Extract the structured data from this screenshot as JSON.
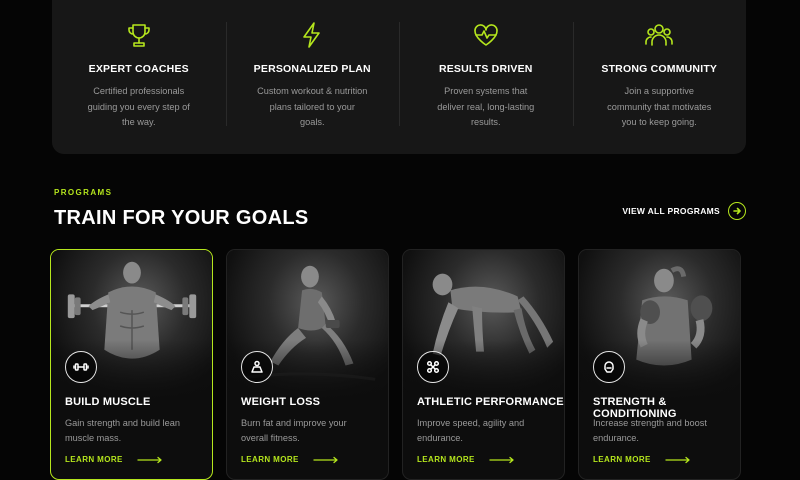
{
  "features": [
    {
      "icon": "trophy-icon",
      "title": "EXPERT COACHES",
      "text": "Certified professionals guiding you every step of the way."
    },
    {
      "icon": "lightning-icon",
      "title": "PERSONALIZED PLAN",
      "text": "Custom workout & nutrition plans tailored to your goals."
    },
    {
      "icon": "heart-pulse-icon",
      "title": "RESULTS DRIVEN",
      "text": "Proven systems that deliver real, long-lasting results."
    },
    {
      "icon": "community-icon",
      "title": "STRONG COMMUNITY",
      "text": "Join a supportive community that motivates you to keep going."
    }
  ],
  "programs": {
    "eyebrow": "PROGRAMS",
    "title": "TRAIN FOR YOUR GOALS",
    "view_all": "VIEW ALL PROGRAMS",
    "cards": [
      {
        "icon": "dumbbell-icon",
        "title": "BUILD MUSCLE",
        "text": "Gain strength and build lean muscle mass.",
        "link": "LEARN MORE"
      },
      {
        "icon": "weight-scale-icon",
        "title": "WEIGHT LOSS",
        "text": "Burn fat and improve your overall fitness.",
        "link": "LEARN MORE"
      },
      {
        "icon": "agility-icon",
        "title": "ATHLETIC PERFORMANCE",
        "text": "Improve speed, agility and endurance.",
        "link": "LEARN MORE"
      },
      {
        "icon": "boxing-glove-icon",
        "title": "STRENGTH & CONDITIONING",
        "text": "Increase strength and boost endurance.",
        "link": "LEARN MORE"
      }
    ]
  },
  "colors": {
    "accent": "#b5e61d",
    "background": "#050505",
    "panel": "#171717",
    "muted_text": "#9a9a9a"
  }
}
